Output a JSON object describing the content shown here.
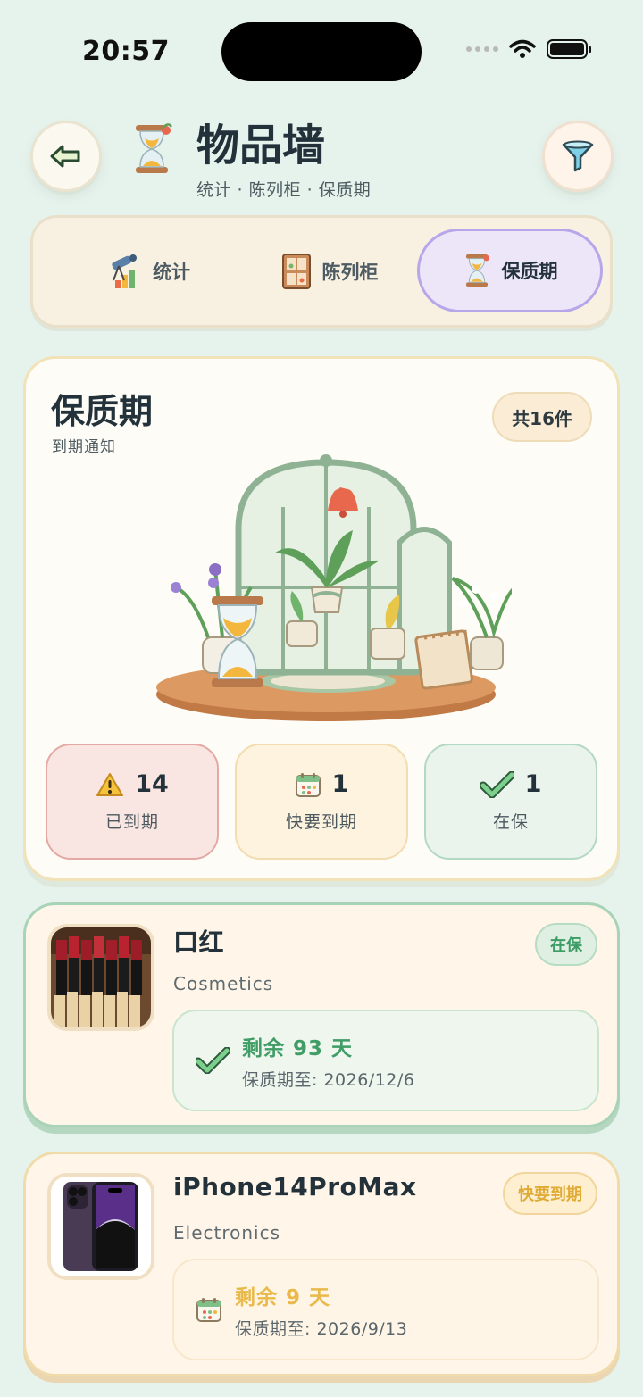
{
  "status_bar": {
    "time": "20:57"
  },
  "header": {
    "title": "物品墙",
    "subtitle": "统计 · 陈列柜 · 保质期",
    "back_icon": "arrow-left-icon",
    "filter_icon": "funnel-icon"
  },
  "tabs": [
    {
      "label": "统计",
      "icon": "telescope-chart-icon",
      "active": false
    },
    {
      "label": "陈列柜",
      "icon": "cabinet-icon",
      "active": false
    },
    {
      "label": "保质期",
      "icon": "hourglass-icon",
      "active": true
    }
  ],
  "expiry_card": {
    "title": "保质期",
    "subtitle": "到期通知",
    "total_badge": "共16件",
    "illustration": "greenhouse-hourglass-illustration",
    "stats": [
      {
        "icon": "warning-icon",
        "count": "14",
        "label": "已到期",
        "color": "#f9e6e3"
      },
      {
        "icon": "calendar-icon",
        "count": "1",
        "label": "快要到期",
        "color": "#fdf3df"
      },
      {
        "icon": "check-icon",
        "count": "1",
        "label": "在保",
        "color": "#eaf3ec"
      }
    ]
  },
  "items": [
    {
      "name": "口红",
      "category": "Cosmetics",
      "status": "在保",
      "remaining": "剩余 93 天",
      "expiry": "保质期至: 2026/12/6",
      "status_color": "#3f9d65"
    },
    {
      "name": "iPhone14ProMax",
      "category": "Electronics",
      "status": "快要到期",
      "remaining": "剩余 9 天",
      "expiry": "保质期至: 2026/9/13",
      "status_color": "#e9b94a"
    }
  ]
}
